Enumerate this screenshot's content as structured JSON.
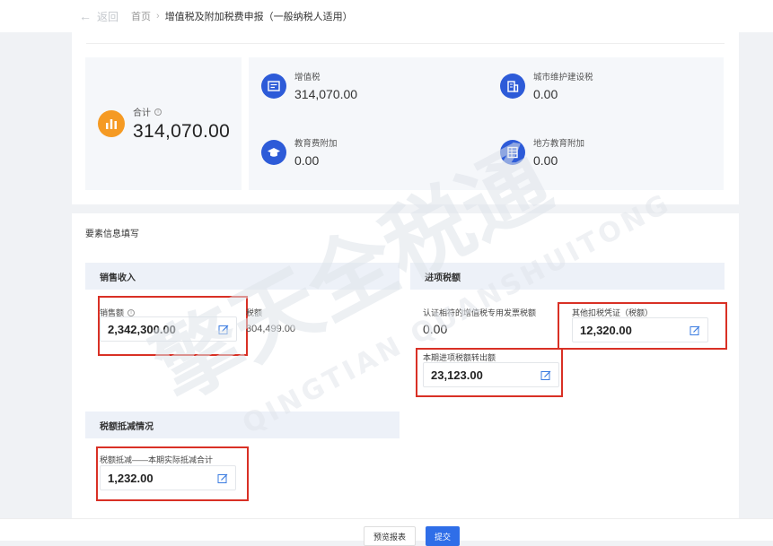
{
  "topbar": {
    "back_label": "返回",
    "breadcrumb_home": "首页",
    "breadcrumb_sep": "›",
    "breadcrumb_current": "增值税及附加税费申报（一般纳税人适用）"
  },
  "summary": {
    "total_label": "合计",
    "total_value": "314,070.00",
    "items": [
      {
        "label": "增值税",
        "value": "314,070.00",
        "icon": "invoice-icon"
      },
      {
        "label": "城市维护建设税",
        "value": "0.00",
        "icon": "building-icon"
      },
      {
        "label": "教育费附加",
        "value": "0.00",
        "icon": "graduation-cap-icon"
      },
      {
        "label": "地方教育附加",
        "value": "0.00",
        "icon": "document-list-icon"
      }
    ]
  },
  "form": {
    "section_title": "要素信息填写",
    "sales": {
      "header": "销售收入",
      "sales_amount_label": "销售额",
      "sales_amount_value": "2,342,300.00",
      "tax_label": "税额",
      "tax_value": "304,499.00"
    },
    "input_tax": {
      "header": "进项税额",
      "certified_label": "认证相符的增值税专用发票税额",
      "certified_value": "0.00",
      "other_voucher_label": "其他扣税凭证（税额）",
      "other_voucher_value": "12,320.00",
      "transfer_out_label": "本期进项税额转出额",
      "transfer_out_value": "23,123.00"
    },
    "deduction": {
      "header": "税额抵减情况",
      "actual_label": "税额抵减——本期实际抵减合计",
      "actual_value": "1,232.00"
    }
  },
  "footer": {
    "preview_label": "预览报表",
    "submit_label": "提交"
  },
  "watermark": {
    "cn": "擎天全税通",
    "en": "QINGTIAN QUANSHUITONG"
  },
  "colors": {
    "accent": "#2d5bd8",
    "total_icon": "#f59a23",
    "highlight_border": "#d93025",
    "primary_button": "#2f6ee8"
  }
}
